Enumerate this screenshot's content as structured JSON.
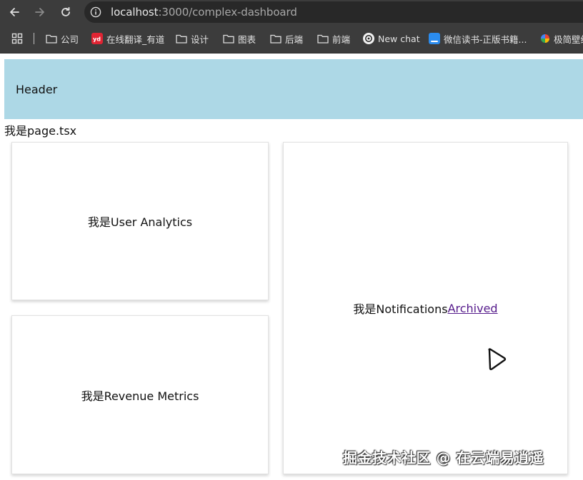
{
  "browser": {
    "url_host": "localhost",
    "url_path": ":3000/complex-dashboard",
    "bookmarks": [
      {
        "label": "公司",
        "icon": "folder-icon"
      },
      {
        "label": "在线翻译_有道",
        "icon": "youdao-icon"
      },
      {
        "label": "设计",
        "icon": "folder-icon"
      },
      {
        "label": "图表",
        "icon": "folder-icon"
      },
      {
        "label": "后端",
        "icon": "folder-icon"
      },
      {
        "label": "前端",
        "icon": "folder-icon"
      },
      {
        "label": "New chat",
        "icon": "openai-icon"
      },
      {
        "label": "微信读书-正版书籍...",
        "icon": "weread-icon"
      },
      {
        "label": "极简壁纸",
        "icon": "pinwheel-icon"
      }
    ],
    "colors": {
      "toolbar": "#3c3c3c",
      "omnibox": "#282828"
    }
  },
  "page": {
    "header_title": "Header",
    "page_label": "我是page.tsx",
    "cards": {
      "analytics": "我是User Analytics",
      "revenue": "我是Revenue Metrics",
      "notifications": "我是Notifications",
      "notifications_link": "Archived"
    },
    "colors": {
      "header_bg": "#add8e6",
      "link": "#551a8b"
    }
  },
  "watermark": "掘金技术社区 @ 在云端易逍遥"
}
